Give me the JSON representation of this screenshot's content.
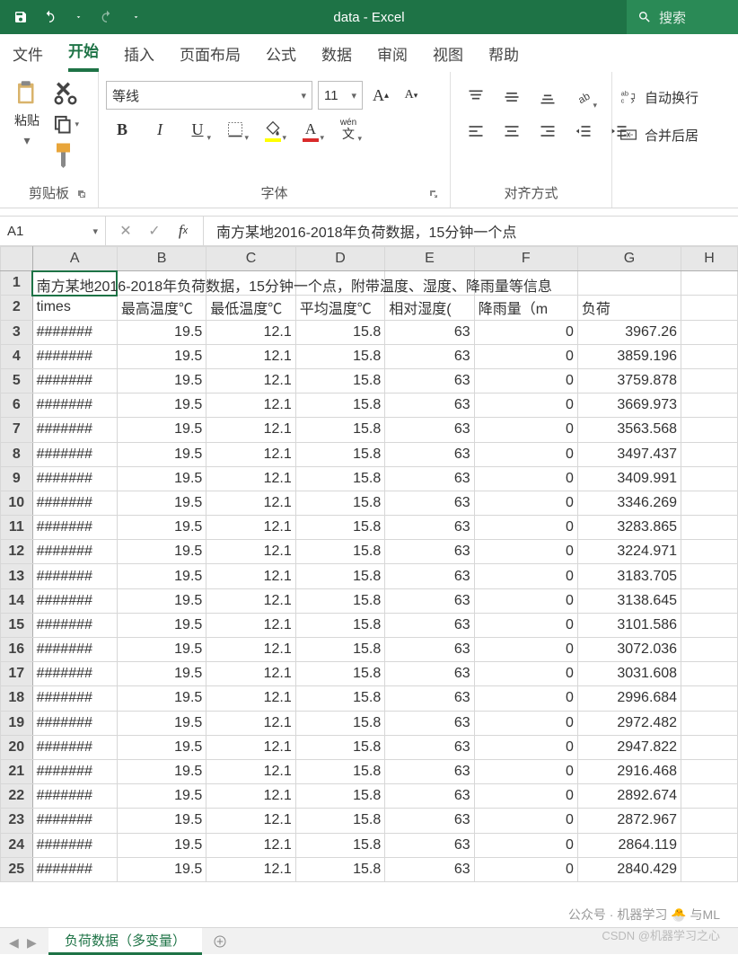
{
  "title": "data  -  Excel",
  "search_placeholder": "搜索",
  "tabs": [
    "文件",
    "开始",
    "插入",
    "页面布局",
    "公式",
    "数据",
    "审阅",
    "视图",
    "帮助"
  ],
  "active_tab": 1,
  "ribbon": {
    "clipboard": {
      "label": "剪贴板",
      "paste": "粘贴"
    },
    "font": {
      "label": "字体",
      "name": "等线",
      "size": "11",
      "wen": "wén",
      "wen2": "文"
    },
    "align": {
      "label": "对齐方式"
    },
    "extras": {
      "wrap": "自动换行",
      "merge": "合并后居"
    }
  },
  "namebox": "A1",
  "formula": "南方某地2016-2018年负荷数据，15分钟一个点",
  "columns": [
    "A",
    "B",
    "C",
    "D",
    "E",
    "F",
    "G",
    "H"
  ],
  "row1_text": "南方某地2016-2018年负荷数据，15分钟一个点，附带温度、湿度、降雨量等信息",
  "headers": [
    "times",
    "最高温度℃",
    "最低温度℃",
    "平均温度℃",
    "相对湿度(",
    "降雨量（m",
    "负荷",
    ""
  ],
  "rows": [
    [
      "#######",
      "19.5",
      "12.1",
      "15.8",
      "63",
      "0",
      "3967.26",
      ""
    ],
    [
      "#######",
      "19.5",
      "12.1",
      "15.8",
      "63",
      "0",
      "3859.196",
      ""
    ],
    [
      "#######",
      "19.5",
      "12.1",
      "15.8",
      "63",
      "0",
      "3759.878",
      ""
    ],
    [
      "#######",
      "19.5",
      "12.1",
      "15.8",
      "63",
      "0",
      "3669.973",
      ""
    ],
    [
      "#######",
      "19.5",
      "12.1",
      "15.8",
      "63",
      "0",
      "3563.568",
      ""
    ],
    [
      "#######",
      "19.5",
      "12.1",
      "15.8",
      "63",
      "0",
      "3497.437",
      ""
    ],
    [
      "#######",
      "19.5",
      "12.1",
      "15.8",
      "63",
      "0",
      "3409.991",
      ""
    ],
    [
      "#######",
      "19.5",
      "12.1",
      "15.8",
      "63",
      "0",
      "3346.269",
      ""
    ],
    [
      "#######",
      "19.5",
      "12.1",
      "15.8",
      "63",
      "0",
      "3283.865",
      ""
    ],
    [
      "#######",
      "19.5",
      "12.1",
      "15.8",
      "63",
      "0",
      "3224.971",
      ""
    ],
    [
      "#######",
      "19.5",
      "12.1",
      "15.8",
      "63",
      "0",
      "3183.705",
      ""
    ],
    [
      "#######",
      "19.5",
      "12.1",
      "15.8",
      "63",
      "0",
      "3138.645",
      ""
    ],
    [
      "#######",
      "19.5",
      "12.1",
      "15.8",
      "63",
      "0",
      "3101.586",
      ""
    ],
    [
      "#######",
      "19.5",
      "12.1",
      "15.8",
      "63",
      "0",
      "3072.036",
      ""
    ],
    [
      "#######",
      "19.5",
      "12.1",
      "15.8",
      "63",
      "0",
      "3031.608",
      ""
    ],
    [
      "#######",
      "19.5",
      "12.1",
      "15.8",
      "63",
      "0",
      "2996.684",
      ""
    ],
    [
      "#######",
      "19.5",
      "12.1",
      "15.8",
      "63",
      "0",
      "2972.482",
      ""
    ],
    [
      "#######",
      "19.5",
      "12.1",
      "15.8",
      "63",
      "0",
      "2947.822",
      ""
    ],
    [
      "#######",
      "19.5",
      "12.1",
      "15.8",
      "63",
      "0",
      "2916.468",
      ""
    ],
    [
      "#######",
      "19.5",
      "12.1",
      "15.8",
      "63",
      "0",
      "2892.674",
      ""
    ],
    [
      "#######",
      "19.5",
      "12.1",
      "15.8",
      "63",
      "0",
      "2872.967",
      ""
    ],
    [
      "#######",
      "19.5",
      "12.1",
      "15.8",
      "63",
      "0",
      "2864.119",
      ""
    ],
    [
      "#######",
      "19.5",
      "12.1",
      "15.8",
      "63",
      "0",
      "2840.429",
      ""
    ]
  ],
  "sheet_name": "负荷数据（多变量）",
  "watermark1": "公众号 · 机器学习 🐣 与ML",
  "watermark2": "CSDN @机器学习之心"
}
